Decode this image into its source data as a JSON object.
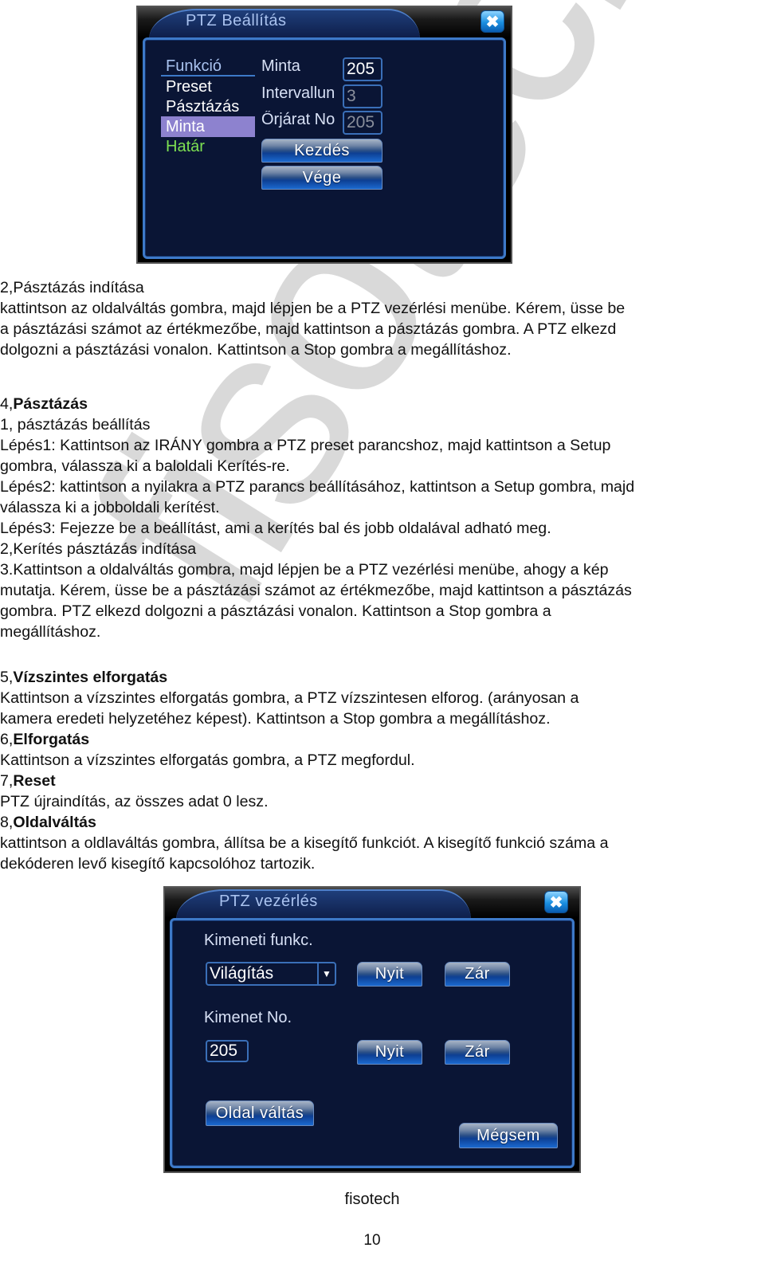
{
  "watermark": "fisotech",
  "dialog_setup": {
    "title": "PTZ Beállítás",
    "close_icon": "✖",
    "menu": {
      "header": "Funkció",
      "items": [
        "Preset",
        "Pásztázás",
        "Minta",
        "Határ"
      ],
      "selected": "Minta"
    },
    "fields": [
      {
        "label": "Minta",
        "value": "205"
      },
      {
        "label": "Intervallun",
        "value": "3"
      },
      {
        "label": "Őrjárat No",
        "value": "205"
      }
    ],
    "buttons": {
      "start": "Kezdés",
      "stop": "Vége"
    }
  },
  "doc": {
    "section2_start": {
      "heading": "2,Pásztázás indítása",
      "body_lines": [
        "kattintson az oldalváltás gombra, majd lépjen be a PTZ vezérlési menübe. Kérem, üsse be",
        "a pásztázási számot az értékmezőbe, majd kattintson a pásztázás gombra. A  PTZ elkezd",
        "dolgozni a pásztázási vonalon. Kattintson a Stop gombra a megállításhoz."
      ]
    },
    "section4": {
      "num": "4,",
      "title": "Pásztázás",
      "lines": [
        "1, pásztázás beállítás",
        "Lépés1: Kattintson az IRÁNY gombra a PTZ preset parancshoz, majd kattintson a Setup",
        "gombra, válassza ki a baloldali Kerítés-re.",
        "Lépés2: kattintson a nyilakra a PTZ parancs beállításához, kattintson a Setup gombra, majd",
        "válassza ki a jobboldali kerítést.",
        "Lépés3: Fejezze be a beállítást, ami a kerítés bal és jobb oldalával adható meg.",
        "2,Kerítés pásztázás indítása",
        "3.Kattintson a oldalváltás gombra, majd lépjen be a PTZ vezérlési menübe, ahogy a kép",
        "mutatja. Kérem, üsse be a pásztázási számot az értékmezőbe, majd kattintson a pásztázás",
        "gombra. PTZ elkezd dolgozni a pásztázási vonalon. Kattintson a Stop gombra a",
        "megállításhoz."
      ]
    },
    "section5": {
      "num": "5,",
      "title": "Vízszintes elforgatás",
      "lines": [
        "Kattintson a vízszintes elforgatás gombra, a PTZ vízszintesen elforog. (arányosan a",
        "kamera eredeti helyzetéhez képest). Kattintson a Stop gombra a megállításhoz."
      ]
    },
    "section6": {
      "num": "6,",
      "title": "Elforgatás",
      "lines": [
        "Kattintson a vízszintes elforgatás gombra, a PTZ megfordul."
      ]
    },
    "section7": {
      "num": "7,",
      "title": "Reset",
      "lines": [
        "PTZ újraindítás, az összes adat 0 lesz."
      ]
    },
    "section8": {
      "num": "8,",
      "title": "Oldalváltás",
      "lines": [
        "kattintson a oldlaváltás gombra, állítsa be a kisegítő funkciót. A kisegítő funkció száma a",
        "dekóderen levő kisegítő kapcsolóhoz tartozik."
      ]
    }
  },
  "dialog_control": {
    "title": "PTZ vezérlés",
    "close_icon": "✖",
    "output_function_label": "Kimeneti funkc.",
    "output_function_value": "Világítás",
    "dropdown_icon": "▼",
    "output_no_label": "Kimenet No.",
    "output_no_value": "205",
    "buttons": {
      "open1": "Nyit",
      "close1": "Zár",
      "open2": "Nyit",
      "close2": "Zár",
      "page_switch": "Oldal váltás",
      "cancel": "Mégsem"
    }
  },
  "footer": {
    "brand": "fisotech",
    "page_number": "10"
  }
}
